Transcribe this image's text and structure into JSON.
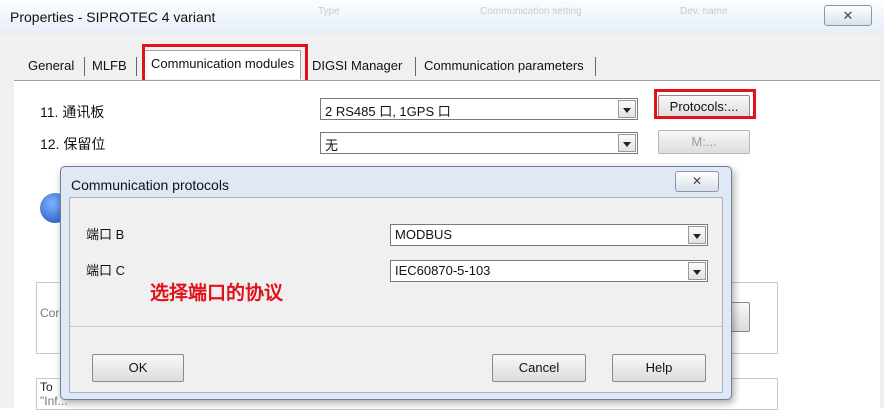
{
  "window": {
    "title": "Properties - SIPROTEC 4 variant",
    "close_glyph": "✕",
    "ghost_header": [
      "Type",
      "Communication setting",
      "Dev. name"
    ]
  },
  "tabs": [
    {
      "label": "General"
    },
    {
      "label": "MLFB"
    },
    {
      "label": "Communication modules",
      "active": true
    },
    {
      "label": "DIGSI Manager"
    },
    {
      "label": "Communication parameters"
    }
  ],
  "comm_modules": {
    "row11": {
      "label": "11. 通讯板",
      "value": "2 RS485 口, 1GPS 口",
      "button": "Protocols:..."
    },
    "row12": {
      "label": "12. 保留位",
      "value": "无",
      "button": "M:..."
    }
  },
  "background": {
    "groupbox_faint_text": "Cor",
    "bottom_text_line1": "To",
    "bottom_text_line2": "\"Inf..."
  },
  "dialog": {
    "title": "Communication protocols",
    "close_glyph": "✕",
    "port_b": {
      "label": "端口 B",
      "value": "MODBUS"
    },
    "port_c": {
      "label": "端口 C",
      "value": "IEC60870-5-103"
    },
    "annotation": "选择端口的协议",
    "ok_label": "OK",
    "cancel_label": "Cancel",
    "help_label": "Help"
  },
  "colors": {
    "highlight": "#e0121a"
  }
}
